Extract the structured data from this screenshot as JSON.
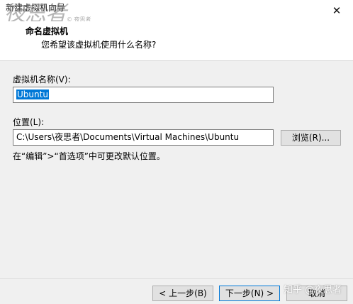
{
  "window": {
    "title": "新建虚拟机向导",
    "close_glyph": "✕"
  },
  "header": {
    "title": "命名虚拟机",
    "subtitle": "您希望该虚拟机使用什么名称?"
  },
  "form": {
    "name_label": "虚拟机名称(V):",
    "name_value": "Ubuntu",
    "location_label": "位置(L):",
    "location_value": "C:\\Users\\夜思者\\Documents\\Virtual Machines\\Ubuntu",
    "browse_label": "浏览(R)...",
    "hint": "在“编辑”>“首选项”中可更改默认位置。"
  },
  "buttons": {
    "back": "< 上一步(B)",
    "next": "下一步(N) >",
    "cancel": "取消"
  },
  "watermarks": {
    "logo": "夜思者",
    "logo_small": "© 夜思者",
    "bottom_right": "知乎 @夜思者"
  },
  "colors": {
    "selection": "#0078d7",
    "default_button_border": "#0078d7"
  }
}
